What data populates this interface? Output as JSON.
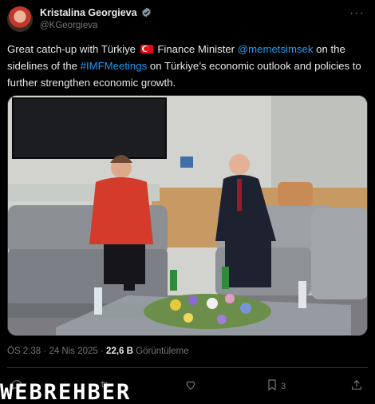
{
  "author": {
    "name": "Kristalina Georgieva",
    "handle": "@KGeorgieva"
  },
  "tweet": {
    "text_1": "Great catch-up with Türkiye ",
    "text_2": " Finance Minister ",
    "mention": "@memetsimsek",
    "text_3": " on the sidelines of the ",
    "hashtag": "#IMFMeetings",
    "text_4": " on Türkiye’s economic outlook and policies to further strengthen economic growth."
  },
  "meta": {
    "time": "ÖS 2:38",
    "sep": " · ",
    "date": "24 Nis 2025",
    "sep2": " · ",
    "views": "22,6 B",
    "views_label": " Görüntüleme"
  },
  "actions": {
    "bookmarks": "3"
  },
  "watermark": "WEBREHBER",
  "colors": {
    "link": "#1d9bf0",
    "verified": "#8b98a5",
    "muted": "#71767b"
  }
}
